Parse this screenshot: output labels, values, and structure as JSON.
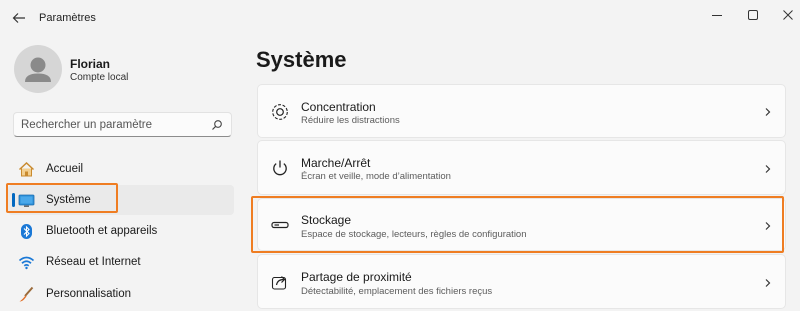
{
  "app": {
    "title": "Paramètres"
  },
  "user": {
    "name": "Florian",
    "account_type": "Compte local"
  },
  "search": {
    "placeholder": "Rechercher un paramètre"
  },
  "sidebar": {
    "items": [
      {
        "label": "Accueil",
        "icon": "home-icon"
      },
      {
        "label": "Système",
        "icon": "monitor-icon",
        "selected": true
      },
      {
        "label": "Bluetooth et appareils",
        "icon": "bluetooth-icon"
      },
      {
        "label": "Réseau et Internet",
        "icon": "wifi-icon"
      },
      {
        "label": "Personnalisation",
        "icon": "brush-icon"
      }
    ]
  },
  "main": {
    "title": "Système",
    "cards": [
      {
        "title": "Concentration",
        "subtitle": "Réduire les distractions",
        "icon": "focus-icon"
      },
      {
        "title": "Marche/Arrêt",
        "subtitle": "Écran et veille, mode d’alimentation",
        "icon": "power-icon"
      },
      {
        "title": "Stockage",
        "subtitle": "Espace de stockage, lecteurs, règles de configuration",
        "icon": "storage-icon",
        "highlighted": true
      },
      {
        "title": "Partage de proximité",
        "subtitle": "Détectabilité, emplacement des fichiers reçus",
        "icon": "share-icon"
      }
    ]
  },
  "colors": {
    "accent": "#0067c0",
    "highlight": "#ef7d22",
    "background": "#f3f3f3",
    "card": "#fbfbfb"
  }
}
